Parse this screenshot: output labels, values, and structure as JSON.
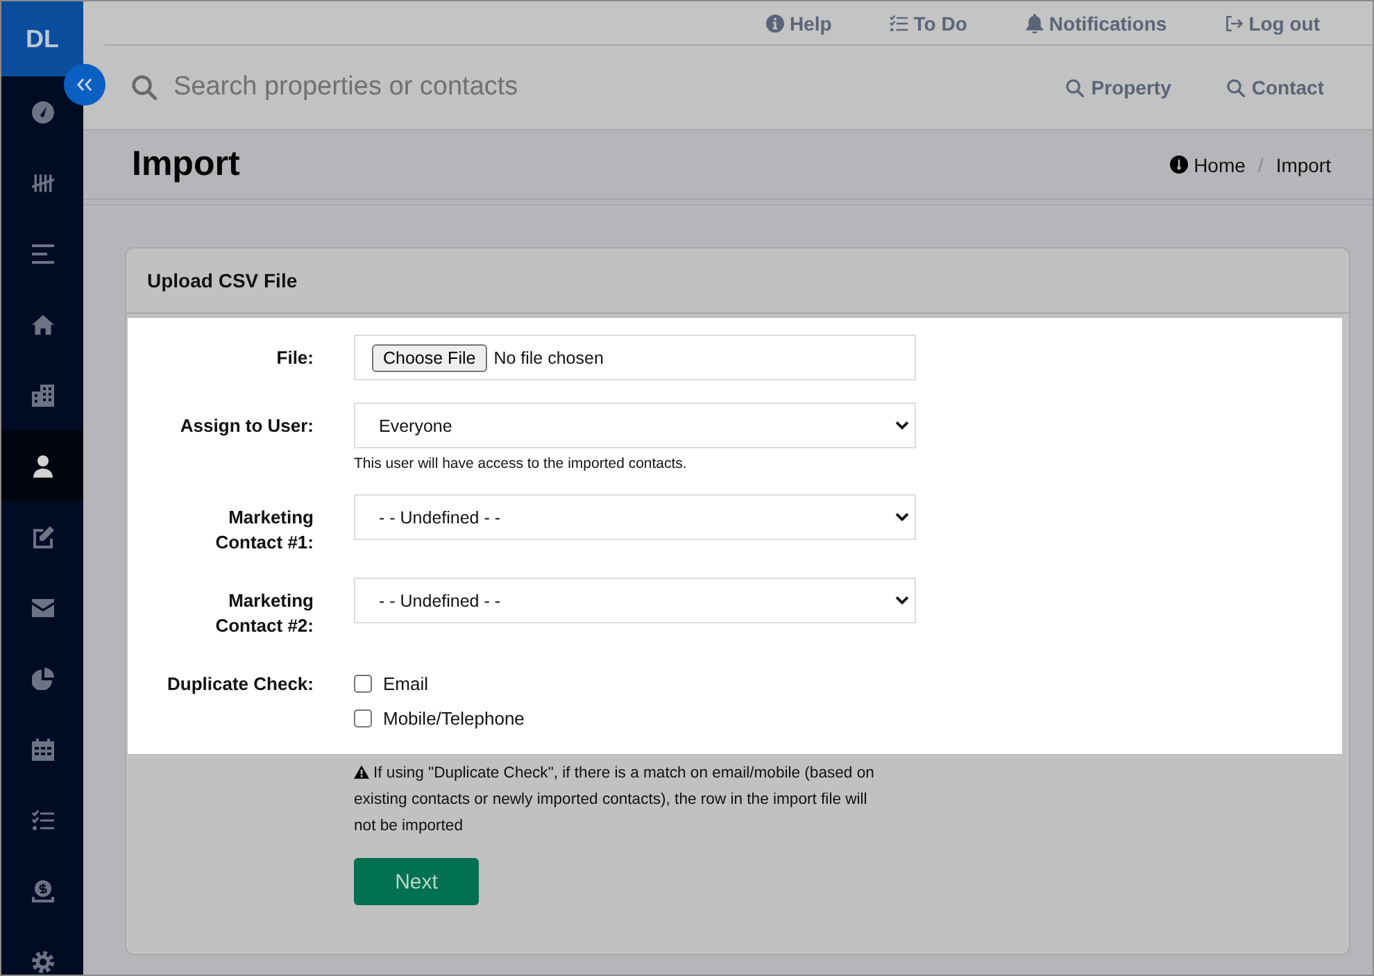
{
  "sidebar": {
    "logo": "DL",
    "items": [
      {
        "kind": "gauge",
        "selected": false
      },
      {
        "kind": "tally",
        "selected": false
      },
      {
        "kind": "lines",
        "selected": false
      },
      {
        "kind": "home",
        "selected": false
      },
      {
        "kind": "building",
        "selected": false
      },
      {
        "kind": "person",
        "selected": true
      },
      {
        "kind": "edit",
        "selected": false
      },
      {
        "kind": "envelope",
        "selected": false
      },
      {
        "kind": "pie",
        "selected": false
      },
      {
        "kind": "calendar",
        "selected": false
      },
      {
        "kind": "checklist",
        "selected": false
      },
      {
        "kind": "coin",
        "selected": false
      },
      {
        "kind": "gear",
        "selected": false
      }
    ]
  },
  "top_links": [
    {
      "kind": "help",
      "label": "Help"
    },
    {
      "kind": "todo",
      "label": "To Do"
    },
    {
      "kind": "notifications",
      "label": "Notifications"
    },
    {
      "kind": "logout",
      "label": "Log out"
    }
  ],
  "search": {
    "placeholder": "Search properties or contacts",
    "scopes": [
      {
        "label": "Property"
      },
      {
        "label": "Contact"
      }
    ]
  },
  "page_header": {
    "title": "Import",
    "breadcrumb": {
      "separator": "/",
      "items": [
        {
          "label": "Home"
        },
        {
          "label": "Import"
        }
      ]
    }
  },
  "card": {
    "title": "Upload CSV File",
    "fields": [
      {
        "kind": "file",
        "label": "File:",
        "button": "Choose File",
        "value": "No file chosen"
      },
      {
        "kind": "select",
        "label": "Assign to User:",
        "value": "Everyone",
        "help": "This user will have access to the imported contacts."
      },
      {
        "kind": "select",
        "label": "Marketing Contact #1:",
        "value": "- - Undefined - -"
      },
      {
        "kind": "select",
        "label": "Marketing Contact #2:",
        "value": "- - Undefined - -"
      },
      {
        "kind": "checkboxes",
        "label": "Duplicate Check:",
        "options": [
          {
            "label": "Email",
            "checked": false
          },
          {
            "label": "Mobile/Telephone",
            "checked": false
          }
        ]
      }
    ],
    "note": "If using \"Duplicate Check\", if there is a match on email/mobile (based on existing contacts or newly imported contacts), the row in the import file will not be imported",
    "submit": "Next"
  }
}
